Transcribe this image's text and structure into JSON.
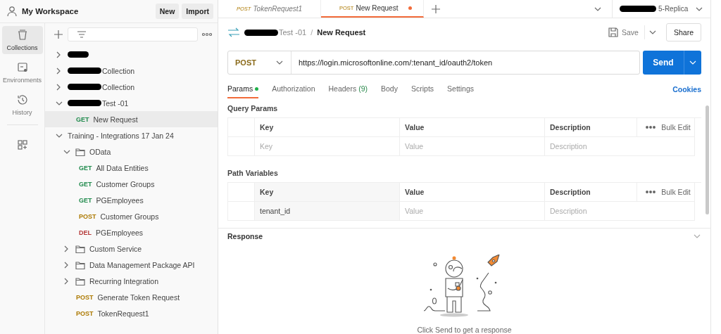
{
  "sidebar": {
    "workspace_title": "My Workspace",
    "buttons": [
      "New",
      "Import"
    ],
    "rail": [
      {
        "kind": "collections",
        "label": "Collections",
        "selected": true
      },
      {
        "kind": "environments",
        "label": "Environments",
        "selected": false
      },
      {
        "kind": "history",
        "label": "History",
        "selected": false
      },
      {
        "kind": "add",
        "selected": false
      }
    ],
    "tree": [
      {
        "kind": "collection",
        "redacted": true,
        "expanded": false
      },
      {
        "kind": "collection",
        "redacted": true,
        "name": "Collection",
        "expanded": false
      },
      {
        "kind": "collection",
        "redacted": true,
        "name": "Collection",
        "expanded": false
      },
      {
        "kind": "collection",
        "redacted": true,
        "name": "Test -01",
        "expanded": true,
        "children": [
          {
            "kind": "request",
            "method": "GET",
            "color": "#1f8a4c",
            "name": "New Request",
            "selected": true
          }
        ]
      },
      {
        "kind": "collection",
        "redacted": false,
        "name": "Training - Integrations 17 Jan 24",
        "expanded": true,
        "children": [
          {
            "kind": "folder",
            "name": "OData",
            "expanded": true,
            "children": [
              {
                "kind": "request",
                "method": "GET",
                "color": "#1f8a4c",
                "name": "All Data Entities",
                "selected": false
              },
              {
                "kind": "request",
                "method": "GET",
                "color": "#1f8a4c",
                "name": "Customer Groups",
                "selected": false
              },
              {
                "kind": "request",
                "method": "GET",
                "color": "#1f8a4c",
                "name": "PGEmployees",
                "selected": false
              },
              {
                "kind": "request",
                "method": "POST",
                "color": "#ad7a03",
                "name": "Customer Groups",
                "selected": false
              },
              {
                "kind": "request",
                "method": "DEL",
                "color": "#b53a3a",
                "name": "PGEmployees",
                "selected": false
              }
            ]
          },
          {
            "kind": "folder",
            "name": "Custom Service",
            "expanded": false
          },
          {
            "kind": "folder",
            "name": "Data Management Package API",
            "expanded": false
          },
          {
            "kind": "folder",
            "name": "Recurring Integration",
            "expanded": false
          },
          {
            "kind": "request",
            "method": "POST",
            "color": "#ad7a03",
            "name": "Generate Token Request",
            "selected": false
          },
          {
            "kind": "request",
            "method": "POST",
            "color": "#ad7a03",
            "name": "TokenRequest1",
            "selected": false
          }
        ]
      }
    ]
  },
  "tabs": [
    {
      "method": "POST",
      "name": "TokenRequest1",
      "selected": false,
      "preview": true,
      "unsaved": false
    },
    {
      "method": "POST",
      "name": "New Request",
      "selected": true,
      "preview": false,
      "unsaved": true
    }
  ],
  "environment": {
    "redacted": true,
    "name": "5-Replica"
  },
  "request": {
    "breadcrumb": {
      "redacted": true,
      "collection": "Test -01",
      "separator": "/",
      "name": "New Request"
    },
    "save": "Save",
    "share": "Share",
    "method": "POST",
    "url": "https://login.microsoftonline.com/:tenant_id/oauth2/token",
    "send": "Send",
    "tabs": [
      {
        "label": "Params",
        "selected": true,
        "indicator": true
      },
      {
        "label": "Authorization",
        "selected": false,
        "indicator": false
      },
      {
        "label": "Headers",
        "count": "(9)",
        "selected": false,
        "indicator": false
      },
      {
        "label": "Body",
        "selected": false,
        "indicator": false
      },
      {
        "label": "Scripts",
        "selected": false,
        "indicator": false
      },
      {
        "label": "Settings",
        "selected": false,
        "indicator": false
      }
    ],
    "cookies": "Cookies",
    "tables": [
      {
        "title": "Query Params",
        "columns": [
          "Key",
          "Value",
          "Description"
        ],
        "bulk_edit": "Bulk Edit",
        "rows": [
          {
            "key": {
              "placeholder": "Key"
            },
            "value": {
              "placeholder": "Value"
            },
            "description": {
              "placeholder": "Description"
            }
          }
        ]
      },
      {
        "title": "Path Variables",
        "columns": [
          "Key",
          "Value",
          "Description"
        ],
        "bulk_edit": "Bulk Edit",
        "rows": [
          {
            "key": {
              "value": "tenant_id"
            },
            "value": {
              "placeholder": "Value"
            },
            "description": {
              "placeholder": "Description"
            }
          }
        ]
      }
    ]
  },
  "response": {
    "title": "Response",
    "hint": "Click Send to get a response"
  }
}
